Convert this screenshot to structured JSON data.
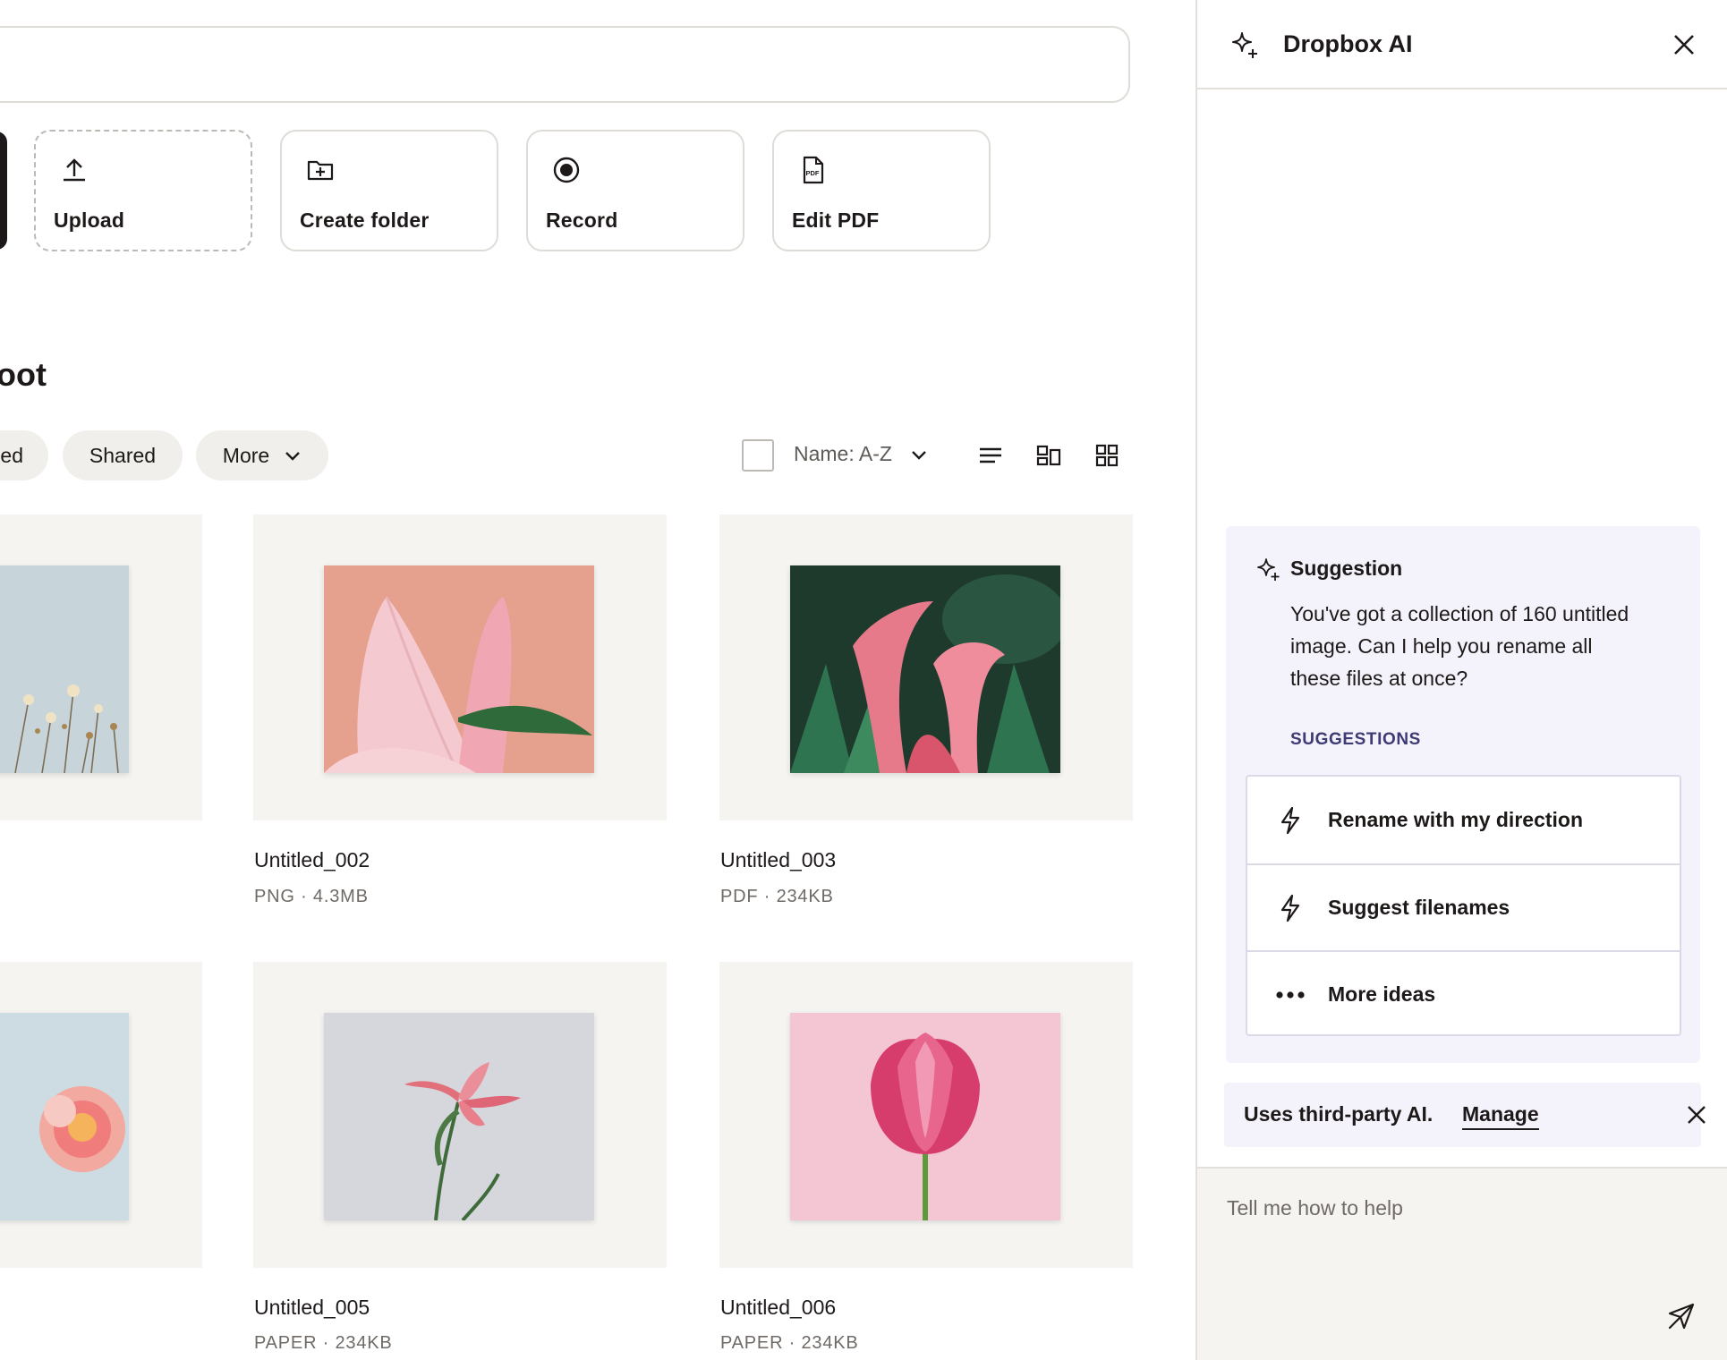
{
  "actions": [
    {
      "label": "Upload",
      "icon": "upload-icon"
    },
    {
      "label": "Create folder",
      "icon": "folder-plus-icon"
    },
    {
      "label": "Record",
      "icon": "record-icon"
    },
    {
      "label": "Edit PDF",
      "icon": "pdf-icon"
    }
  ],
  "breadcrumb": "oot",
  "filters": {
    "partial": "ed",
    "shared": "Shared",
    "more": "More"
  },
  "sort": {
    "label": "Name: A-Z"
  },
  "view_icons": [
    "list-view-icon",
    "tile-view-icon",
    "grid-view-icon"
  ],
  "files": [
    {
      "name": "Untitled_002",
      "meta": "PNG · 4.3MB"
    },
    {
      "name": "Untitled_003",
      "meta": "PDF · 234KB"
    },
    {
      "name": "Untitled_005",
      "meta": "PAPER · 234KB"
    },
    {
      "name": "Untitled_006",
      "meta": "PAPER · 234KB"
    }
  ],
  "ai_panel": {
    "title": "Dropbox AI",
    "suggestion": {
      "title": "Suggestion",
      "body": "You've got a collection of 160 untitled image. Can I help you rename all these files at once?",
      "subheading": "SUGGESTIONS",
      "options": [
        {
          "label": "Rename with my direction",
          "icon": "lightning-icon"
        },
        {
          "label": "Suggest filenames",
          "icon": "lightning-icon"
        },
        {
          "label": "More ideas",
          "icon": "more-dots-icon"
        }
      ]
    },
    "notice": {
      "text": "Uses third-party AI.",
      "link": "Manage"
    },
    "composer": {
      "placeholder": "Tell me how to help"
    }
  },
  "colors": {
    "text": "#1e1919",
    "muted": "#6f6a66",
    "border": "#dfdcd8",
    "thumb_bg": "#f5f4f1",
    "ai_card_bg": "#f4f3fb",
    "ai_accent": "#3d3a74"
  }
}
